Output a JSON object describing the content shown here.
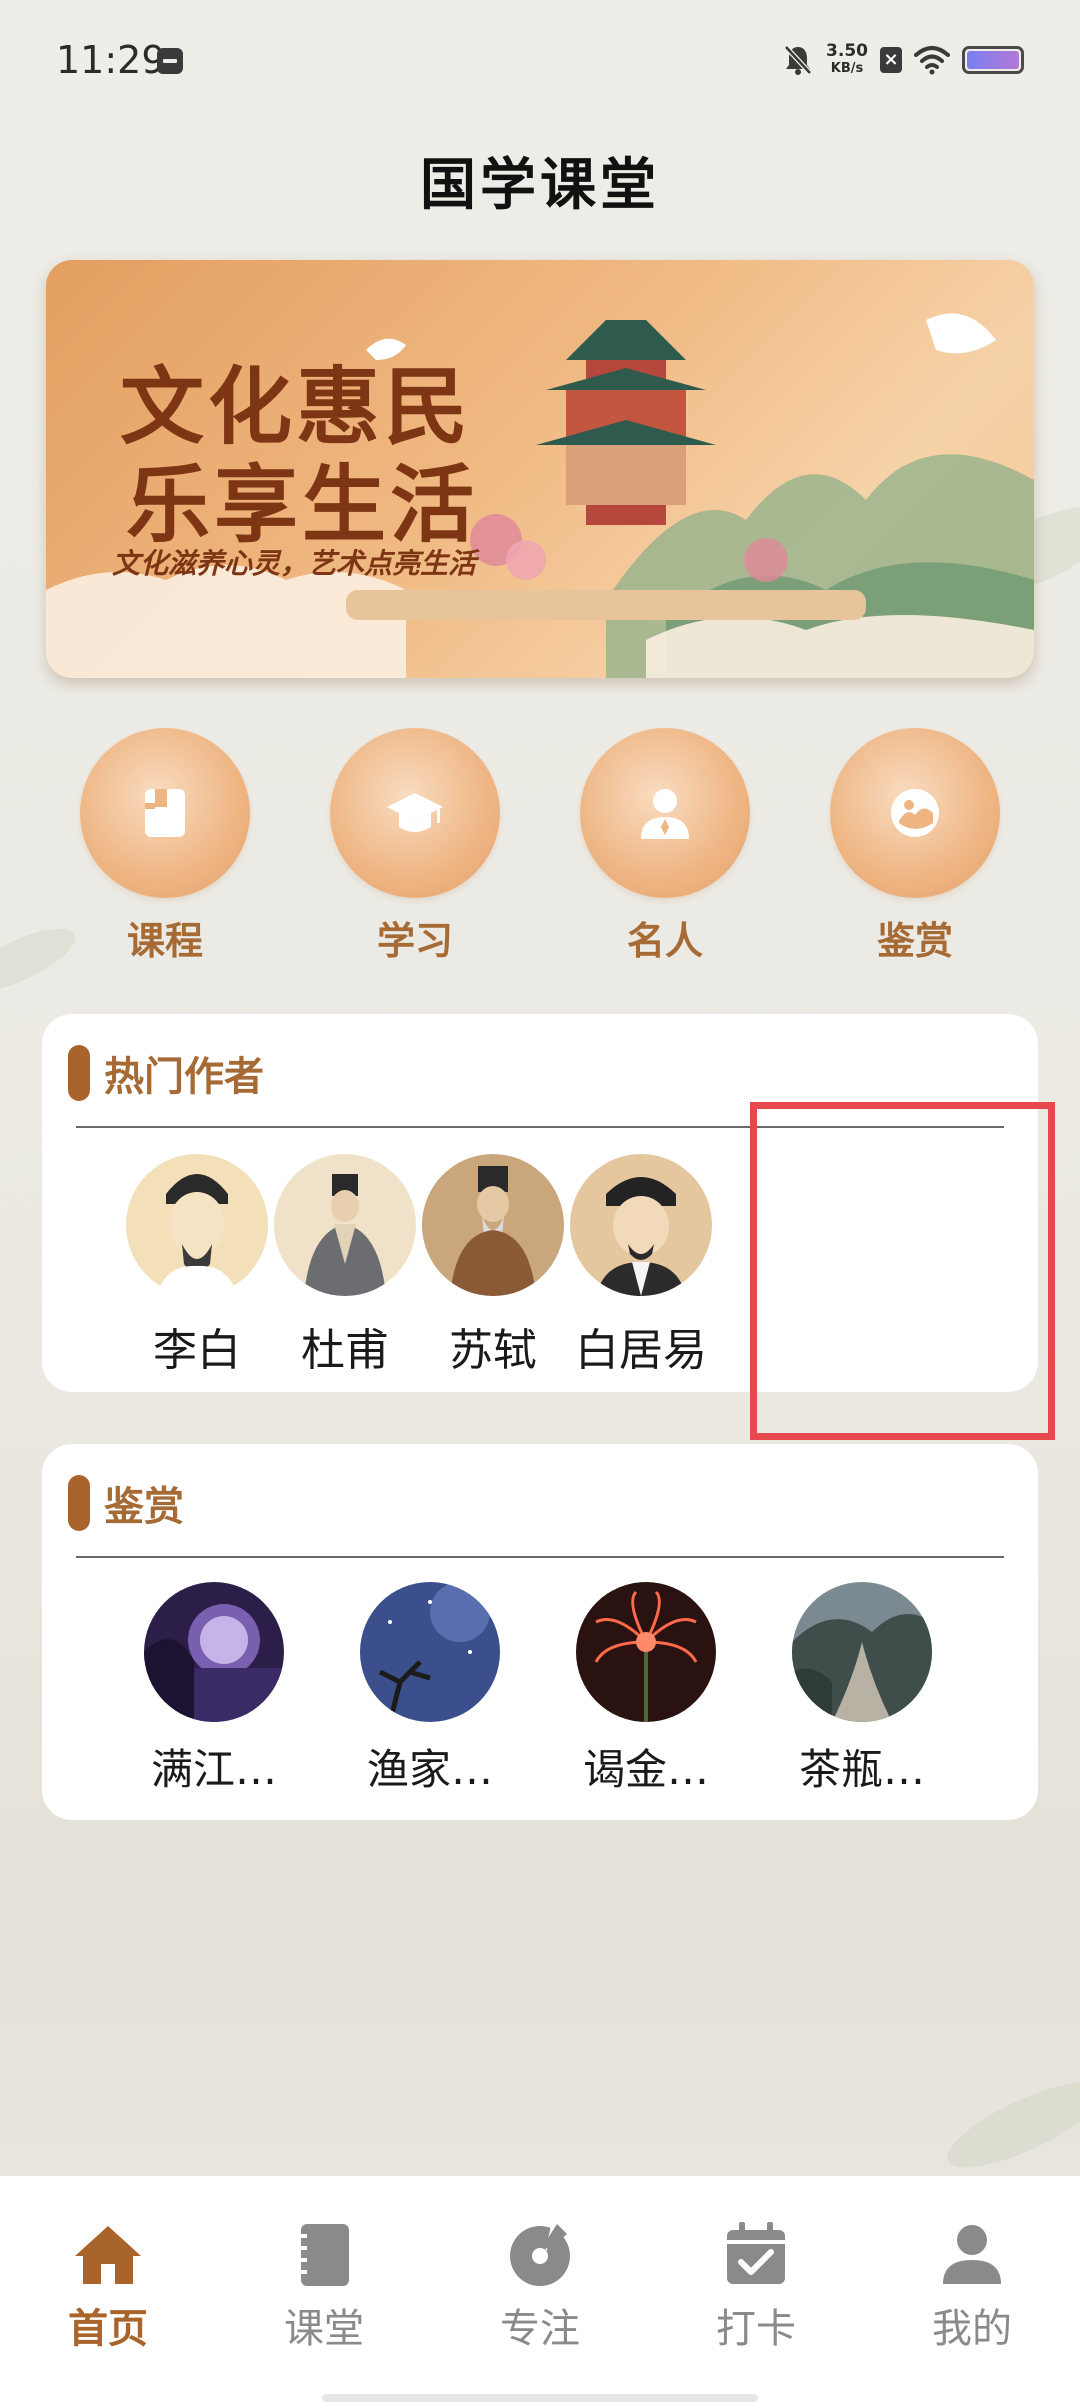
{
  "status_bar": {
    "time": "11:29",
    "net_speed_value": "3.50",
    "net_speed_unit": "KB/s",
    "icons": [
      "notification-app-icon",
      "mute-icon",
      "x-box-icon",
      "wifi-icon",
      "battery-icon"
    ]
  },
  "header": {
    "title": "国学课堂"
  },
  "banner": {
    "line1": "文化惠民",
    "line2": "乐享生活",
    "subtitle": "文化滋养心灵，艺术点亮生活"
  },
  "quick_nav": [
    {
      "label": "课程",
      "icon": "book-icon"
    },
    {
      "label": "学习",
      "icon": "graduation-cap-icon"
    },
    {
      "label": "名人",
      "icon": "person-icon"
    },
    {
      "label": "鉴赏",
      "icon": "appreciation-icon"
    }
  ],
  "hot_authors": {
    "title": "热门作者",
    "items": [
      {
        "name": "李白"
      },
      {
        "name": "杜甫"
      },
      {
        "name": "苏轼"
      },
      {
        "name": "白居易"
      }
    ]
  },
  "appreciation": {
    "title": "鉴赏",
    "items": [
      {
        "title": "满江…"
      },
      {
        "title": "渔家…"
      },
      {
        "title": "谒金…"
      },
      {
        "title": "茶瓶…"
      }
    ]
  },
  "tab_bar": {
    "items": [
      {
        "label": "首页",
        "icon": "home-icon",
        "active": true
      },
      {
        "label": "课堂",
        "icon": "notebook-icon",
        "active": false
      },
      {
        "label": "专注",
        "icon": "focus-disc-icon",
        "active": false
      },
      {
        "label": "打卡",
        "icon": "checkin-calendar-icon",
        "active": false
      },
      {
        "label": "我的",
        "icon": "user-icon",
        "active": false
      }
    ]
  },
  "colors": {
    "accent_brown": "#a8642a",
    "label_brown": "#a66a35",
    "highlight_red": "#e5484d",
    "tab_inactive": "#8a8a8a"
  }
}
